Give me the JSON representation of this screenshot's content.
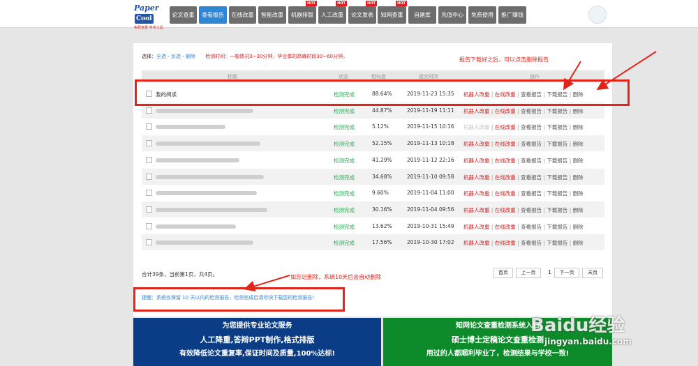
{
  "logo": {
    "line1_a": "Paper",
    "line1_b": "Cool",
    "line2": "免费查重 学术工具"
  },
  "nav": [
    {
      "label": "论文查重",
      "hot": false,
      "active": false
    },
    {
      "label": "查看报告",
      "hot": false,
      "active": true
    },
    {
      "label": "在线改重",
      "hot": false,
      "active": false
    },
    {
      "label": "智能改重",
      "hot": false,
      "active": false
    },
    {
      "label": "机器排版",
      "hot": true,
      "active": false
    },
    {
      "label": "人工改重",
      "hot": true,
      "active": false
    },
    {
      "label": "论文发表",
      "hot": true,
      "active": false
    },
    {
      "label": "知网查重",
      "hot": true,
      "active": false
    },
    {
      "label": "自建库",
      "hot": false,
      "active": false
    },
    {
      "label": "充值中心",
      "hot": false,
      "active": false
    },
    {
      "label": "免费使用",
      "hot": false,
      "active": false
    },
    {
      "label": "推广赚钱",
      "hot": false,
      "active": false
    }
  ],
  "hot_label": "HOT",
  "toolbar": {
    "select_label": "选择：",
    "select_all": "全选",
    "dash": " - ",
    "invert": "反选",
    "delete": "删除",
    "hint": "检测时间：一般情况3~30分钟，毕业季的高峰时段30~60分钟。"
  },
  "annotations": {
    "top": "报告下载好之后，可以点击删除报告",
    "bottom": "如忘记删除，系统10天后会自动删除"
  },
  "table": {
    "headers": [
      "标题",
      "状态",
      "相似度",
      "提交时间",
      "操作"
    ],
    "rows": [
      {
        "title": "我的阅读",
        "status": "检测完成",
        "similarity": "88.64%",
        "time": "2019-11-23 15:35"
      },
      {
        "title": "",
        "status": "检测完成",
        "similarity": "44.87%",
        "time": "2019-11-19 11:11"
      },
      {
        "title": "",
        "status": "检测完成",
        "similarity": "5.12%",
        "time": "2019-11-15 10:16"
      },
      {
        "title": "",
        "status": "检测完成",
        "similarity": "52.15%",
        "time": "2019-11-13 10:18"
      },
      {
        "title": "",
        "status": "检测完成",
        "similarity": "41.29%",
        "time": "2019-11-12 22:16"
      },
      {
        "title": "",
        "status": "检测完成",
        "similarity": "34.68%",
        "time": "2019-11-10 09:58"
      },
      {
        "title": "",
        "status": "检测完成",
        "similarity": "9.60%",
        "time": "2019-11-04 11:00"
      },
      {
        "title": "",
        "status": "检测完成",
        "similarity": "30.16%",
        "time": "2019-11-04 09:56"
      },
      {
        "title": "",
        "status": "检测完成",
        "similarity": "13.62%",
        "time": "2019-10-31 15:49"
      },
      {
        "title": "",
        "status": "检测完成",
        "similarity": "17.56%",
        "time": "2019-10-30 17:02"
      }
    ],
    "ops": {
      "machine": "机器人改重",
      "online": "在线改重",
      "view": "查看报告",
      "download": "下载报告",
      "delete": "删除",
      "sep": " | "
    }
  },
  "pagination": {
    "summary": "合计39条，当前第1页，共4页。",
    "first": "首页",
    "prev": "上一页",
    "current": "1",
    "next": "下一页",
    "last": "末页"
  },
  "notice": "提醒：系统仅保留 10 天以内的检测报告，检测完成后请尽快下载您的检测报告!",
  "banner_left": {
    "line1": "为您提供专业论文服务",
    "line2": "人工降重,答辩PPT制作,格式排版",
    "line3": "有效降低论文重复率,保证时间及质量,100%达标!"
  },
  "banner_right": {
    "line1": "知网论文查重检测系统入口",
    "line2": "硕士博士定稿论文查重检测",
    "line3": "用过的人都顺利毕业了，检测结果与学校一致!"
  },
  "watermark": {
    "brand": "Baidu经验",
    "url": "jingyan.baidu.com"
  },
  "colors": {
    "active_nav": "#2f86d6",
    "nav": "#6d6d6d",
    "status": "#1fae4d",
    "action_red": "#d21e1e",
    "annotation": "#e0251b"
  }
}
